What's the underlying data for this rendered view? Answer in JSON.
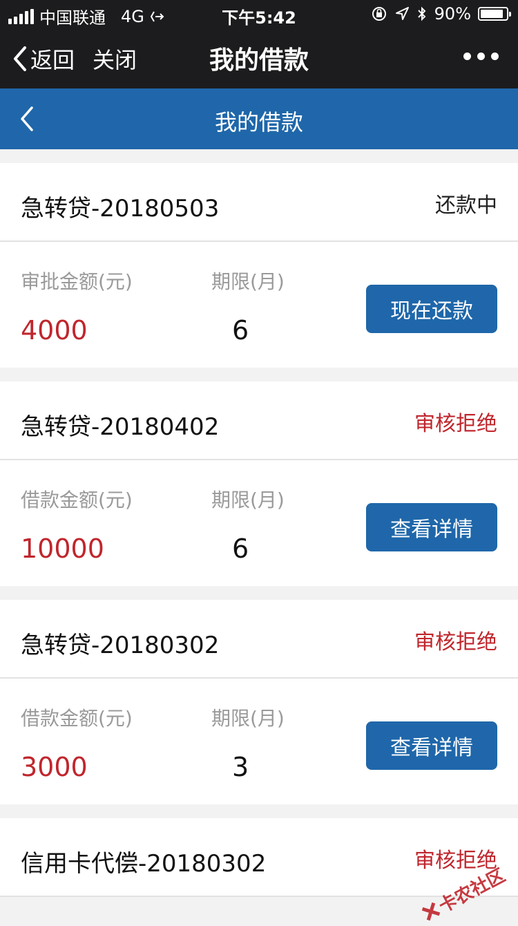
{
  "status_bar": {
    "carrier": "中国联通",
    "network": "4G",
    "time": "下午5:42",
    "battery": "90%",
    "battery_level": 0.9
  },
  "wechat_nav": {
    "back_label": "返回",
    "close_label": "关闭",
    "title": "我的借款"
  },
  "header": {
    "title": "我的借款"
  },
  "colors": {
    "primary": "#1f67aa",
    "danger": "#c0262d",
    "label": "#9a9a9a"
  },
  "loans": [
    {
      "name": "急转贷-20180503",
      "status": "还款中",
      "amount_label": "审批金额(元)",
      "term_label": "期限(月)",
      "amount": "4000",
      "term": "6",
      "button": "现在还款"
    },
    {
      "name": "急转贷-20180402",
      "status": "审核拒绝",
      "amount_label": "借款金额(元)",
      "term_label": "期限(月)",
      "amount": "10000",
      "term": "6",
      "button": "查看详情"
    },
    {
      "name": "急转贷-20180302",
      "status": "审核拒绝",
      "amount_label": "借款金额(元)",
      "term_label": "期限(月)",
      "amount": "3000",
      "term": "3",
      "button": "查看详情"
    },
    {
      "name": "信用卡代偿-20180302",
      "status": "审核拒绝"
    }
  ],
  "watermark": "卡农社区"
}
